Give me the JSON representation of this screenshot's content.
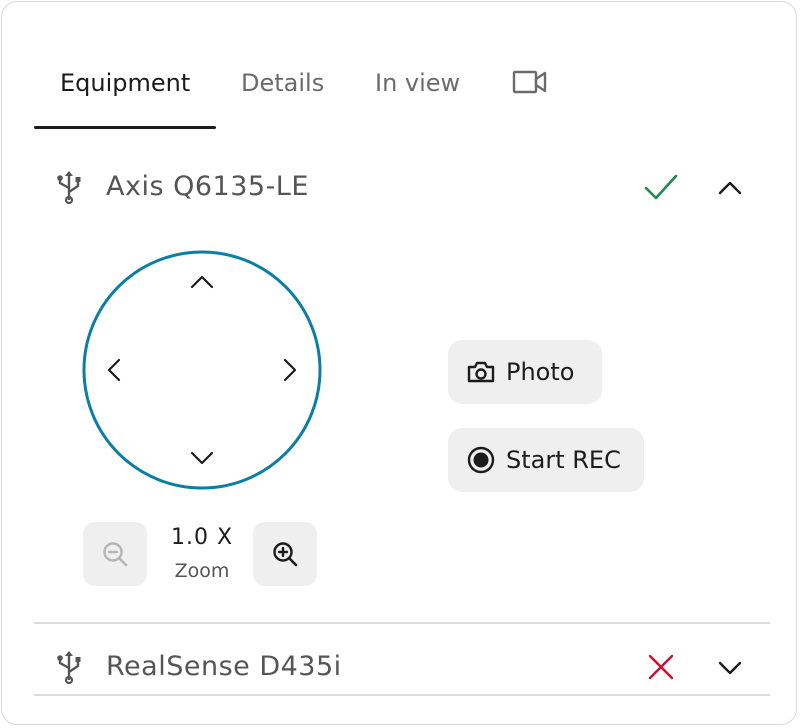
{
  "tabs": [
    {
      "label": "Equipment",
      "active": true
    },
    {
      "label": "Details",
      "active": false
    },
    {
      "label": "In view",
      "active": false
    }
  ],
  "tab_icon": "video-camera-icon",
  "devices": [
    {
      "name": "Axis Q6135-LE",
      "icon": "usb-icon",
      "status": "connected",
      "status_icon": "checkmark-icon",
      "status_color": "#1e8a4f",
      "expanded": true,
      "chevron_icon": "chevron-up-icon"
    },
    {
      "name": "RealSense D435i",
      "icon": "usb-icon",
      "status": "disconnected",
      "status_icon": "cross-icon",
      "status_color": "#c8102e",
      "expanded": false,
      "chevron_icon": "chevron-down-icon"
    }
  ],
  "ptz": {
    "accent_color": "#0a7ea4",
    "controls": [
      "up",
      "down",
      "left",
      "right"
    ],
    "zoom": {
      "value": "1.0 X",
      "label": "Zoom",
      "zoom_out_icon": "zoom-out-icon",
      "zoom_in_icon": "zoom-in-icon",
      "zoom_out_enabled": false
    }
  },
  "actions": {
    "photo": {
      "label": "Photo",
      "icon": "camera-icon"
    },
    "record": {
      "label": "Start REC",
      "icon": "record-icon"
    }
  }
}
